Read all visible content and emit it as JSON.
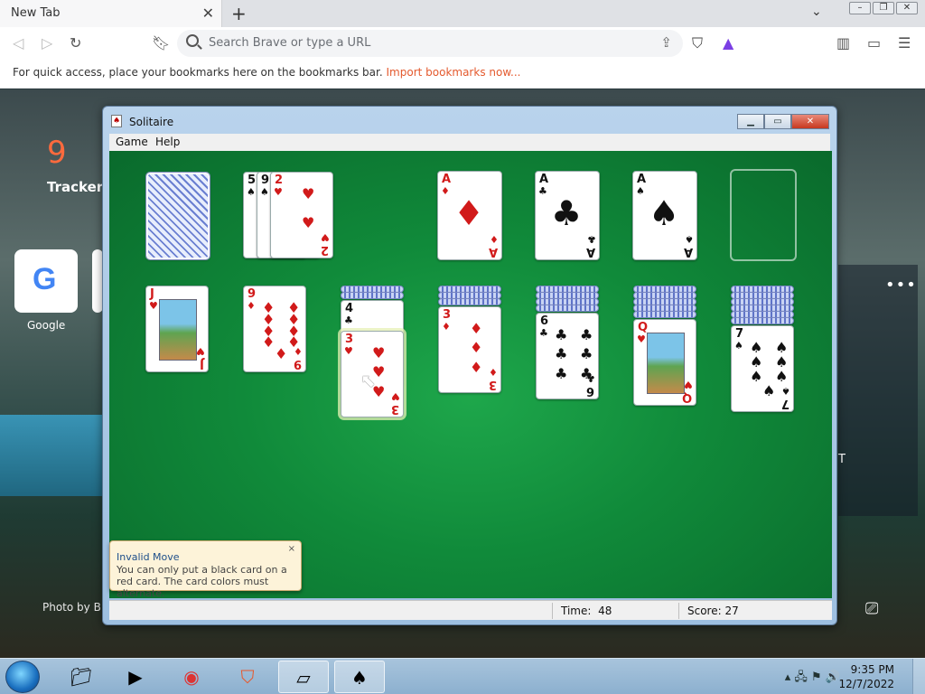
{
  "browser": {
    "tab_title": "New Tab",
    "tab_close": "✕",
    "new_tab": "+",
    "url_placeholder": "Search Brave or type a URL",
    "bookmarks_text": "For quick access, place your bookmarks here on the bookmarks bar.",
    "bookmarks_link": "Import bookmarks now..."
  },
  "newtab_page": {
    "tracker_count": "9",
    "tracker_label": "Trackers",
    "tile_label": "Google",
    "photo_credit": "Photo by B",
    "widget_text": "T"
  },
  "solitaire": {
    "title": "Solitaire",
    "menu": [
      "Game",
      "Help"
    ],
    "status": {
      "time_label": "Time:",
      "time_value": "48",
      "score_label": "Score:",
      "score_value": "27"
    },
    "tooltip": {
      "title": "Invalid Move",
      "body": "You can only put a black card on a red card. The card colors must alternate.",
      "close": "×"
    },
    "waste": [
      {
        "rank": "5",
        "suit": "♠",
        "color": "black"
      },
      {
        "rank": "9",
        "suit": "♠",
        "color": "black"
      },
      {
        "rank": "2",
        "suit": "♥",
        "color": "red"
      }
    ],
    "foundations": [
      {
        "rank": "A",
        "suit": "♦",
        "color": "red"
      },
      {
        "rank": "A",
        "suit": "♣",
        "color": "black"
      },
      {
        "rank": "A",
        "suit": "♠",
        "color": "black"
      },
      {
        "rank": "",
        "suit": "",
        "color": ""
      }
    ],
    "tableau": [
      {
        "hidden": 0,
        "top": {
          "rank": "J",
          "suit": "♥",
          "color": "red"
        }
      },
      {
        "hidden": 0,
        "top": {
          "rank": "9",
          "suit": "♦",
          "color": "red"
        }
      },
      {
        "hidden": 2,
        "under": {
          "rank": "4",
          "suit": "♣",
          "color": "black"
        },
        "top": {
          "rank": "3",
          "suit": "♥",
          "color": "red"
        }
      },
      {
        "hidden": 3,
        "top": {
          "rank": "3",
          "suit": "♦",
          "color": "red"
        }
      },
      {
        "hidden": 4,
        "top": {
          "rank": "6",
          "suit": "♣",
          "color": "black"
        }
      },
      {
        "hidden": 5,
        "top": {
          "rank": "Q",
          "suit": "♥",
          "color": "red"
        }
      },
      {
        "hidden": 6,
        "top": {
          "rank": "7",
          "suit": "♠",
          "color": "black"
        }
      }
    ]
  },
  "taskbar": {
    "time": "9:35 PM",
    "date": "12/7/2022",
    "tray_icons": "▴ 🖧 ⚑ 🔊"
  }
}
